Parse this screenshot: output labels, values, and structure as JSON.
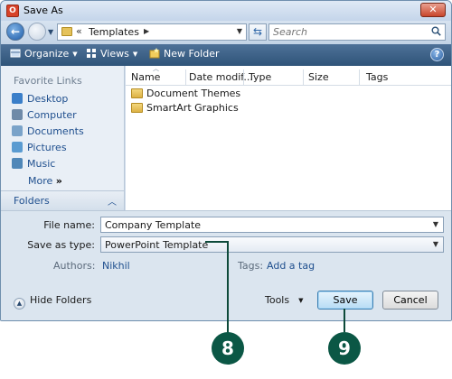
{
  "window": {
    "title": "Save As",
    "app_icon_letter": "O"
  },
  "address": {
    "chevrons": "«",
    "location": "Templates"
  },
  "search": {
    "placeholder": "Search"
  },
  "toolbar": {
    "organize": "Organize",
    "views": "Views",
    "new_folder": "New Folder",
    "help": "?"
  },
  "sidebar": {
    "header": "Favorite Links",
    "links": [
      {
        "label": "Desktop",
        "icon": "desktop-icon"
      },
      {
        "label": "Computer",
        "icon": "computer-icon"
      },
      {
        "label": "Documents",
        "icon": "documents-icon"
      },
      {
        "label": "Pictures",
        "icon": "pictures-icon"
      },
      {
        "label": "Music",
        "icon": "music-icon"
      }
    ],
    "more": "More",
    "more_glyph": "»",
    "folders": "Folders"
  },
  "files": {
    "columns": [
      "Name",
      "Date modif...",
      "Type",
      "Size",
      "Tags"
    ],
    "rows": [
      {
        "name": "Document Themes"
      },
      {
        "name": "SmartArt Graphics"
      }
    ]
  },
  "form": {
    "file_name_label": "File name:",
    "file_name": "Company Template",
    "save_type_label": "Save as type:",
    "save_type": "PowerPoint Template",
    "authors_label": "Authors:",
    "authors": "Nikhil",
    "tags_label": "Tags:",
    "tags_link": "Add a tag"
  },
  "footer": {
    "hide_folders": "Hide Folders",
    "tools": "Tools",
    "save": "Save",
    "cancel": "Cancel"
  },
  "callouts": {
    "first": "8",
    "second": "9"
  },
  "colors": {
    "toolbar": "#3b5f86",
    "link": "#1f4f8e",
    "callout": "#0b5745",
    "close": "#c8452b"
  }
}
